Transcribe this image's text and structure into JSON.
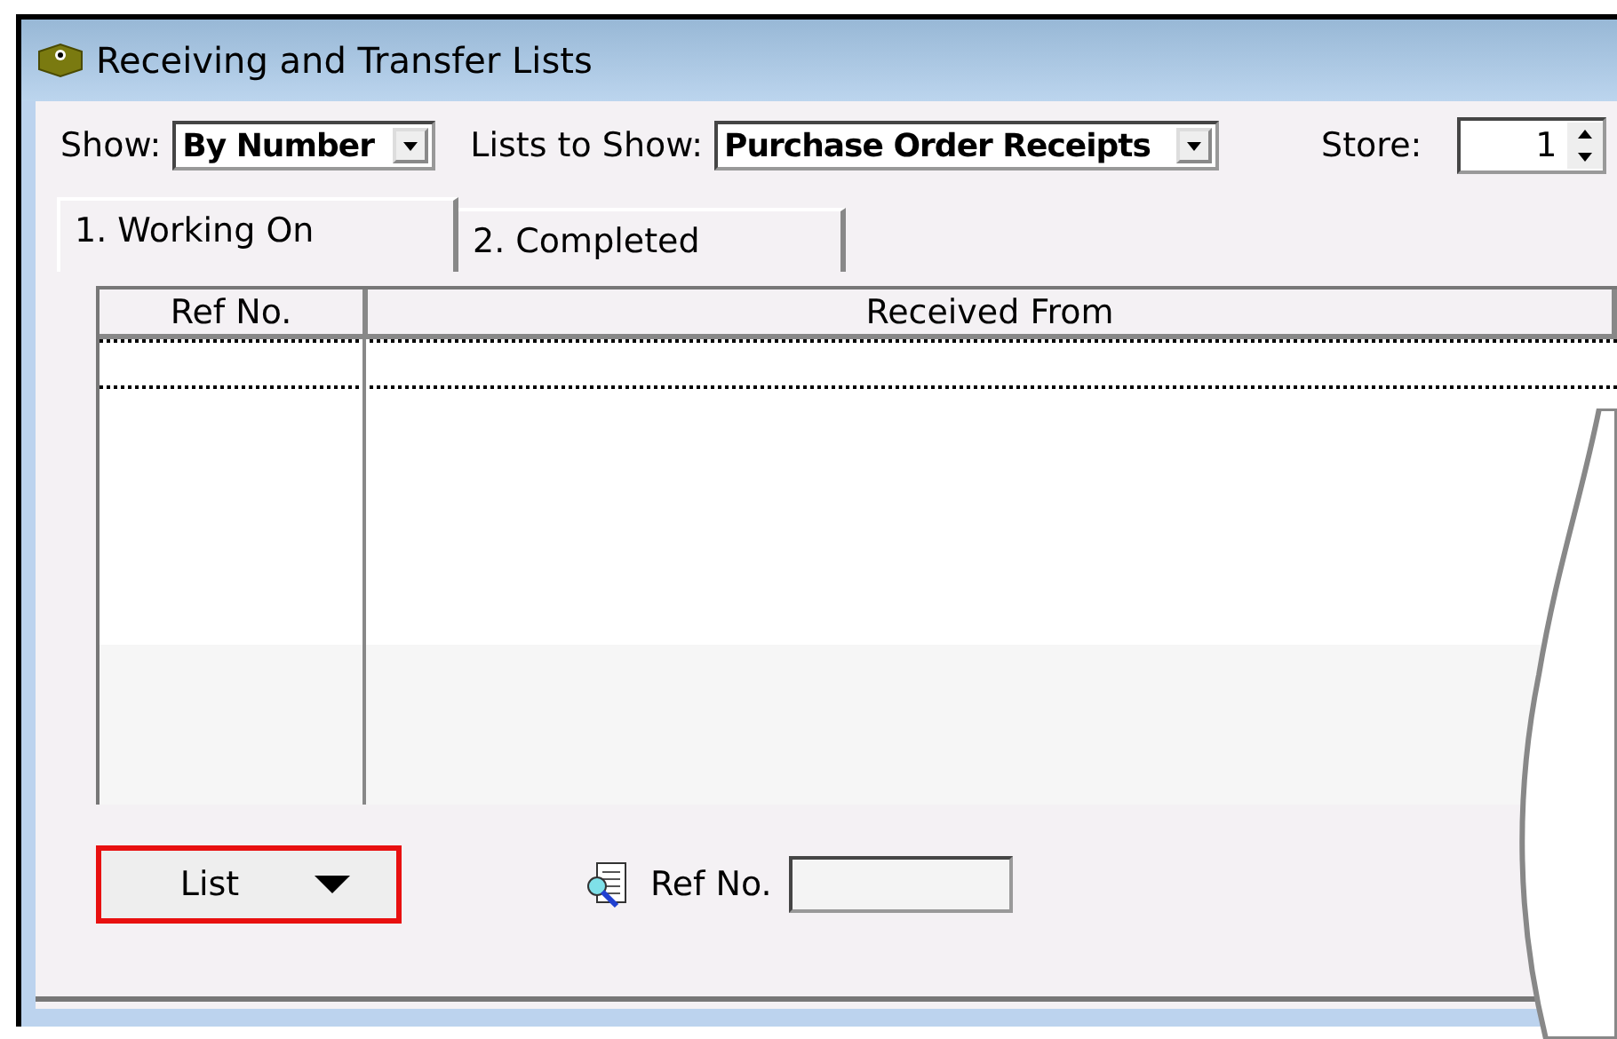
{
  "window": {
    "title": "Receiving and Transfer Lists"
  },
  "filters": {
    "show": {
      "label": "Show:",
      "value": "By Number"
    },
    "lists_to_show": {
      "label": "Lists to Show:",
      "value": "Purchase Order Receipts"
    },
    "store": {
      "label": "Store:",
      "value": "1"
    }
  },
  "tabs": [
    {
      "label": "1. Working On",
      "selected": true
    },
    {
      "label": "2. Completed",
      "selected": false
    }
  ],
  "table": {
    "columns": [
      "Ref No.",
      "Received From"
    ]
  },
  "list_button": {
    "label": "List",
    "highlighted": true
  },
  "ref_search": {
    "label": "Ref No."
  }
}
